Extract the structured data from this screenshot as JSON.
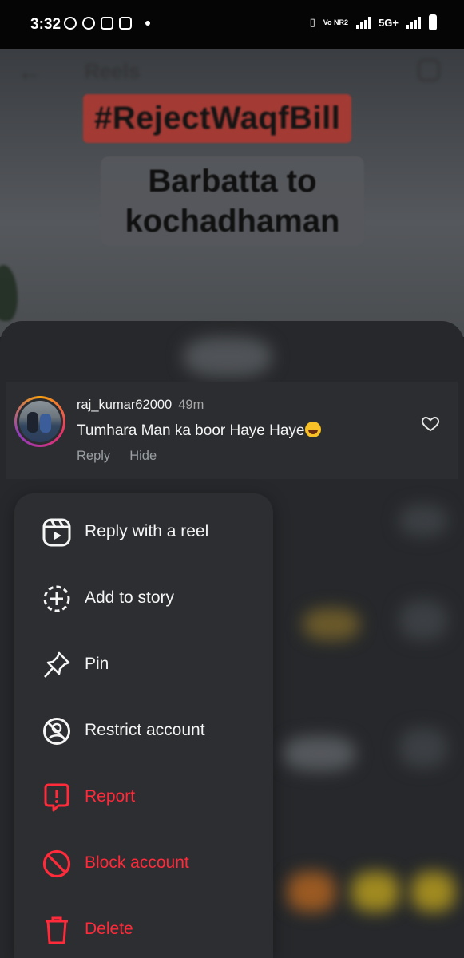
{
  "status_bar": {
    "time": "3:32",
    "network": "5G+",
    "volte": "Vo NR2"
  },
  "reel": {
    "header_title": "Reels",
    "hashtag": "#RejectWaqfBill",
    "caption_line1": "Barbatta to",
    "caption_line2": "kochadhaman"
  },
  "comment": {
    "username": "raj_kumar62000",
    "time": "49m",
    "text": "Tumhara Man ka boor Haye Haye",
    "reply_label": "Reply",
    "hide_label": "Hide"
  },
  "menu": {
    "items": [
      {
        "label": "Reply with a reel",
        "icon": "reel-icon",
        "danger": false
      },
      {
        "label": "Add to story",
        "icon": "add-story-icon",
        "danger": false
      },
      {
        "label": "Pin",
        "icon": "pin-icon",
        "danger": false
      },
      {
        "label": "Restrict account",
        "icon": "restrict-icon",
        "danger": false
      },
      {
        "label": "Report",
        "icon": "report-icon",
        "danger": true
      },
      {
        "label": "Block account",
        "icon": "block-icon",
        "danger": true
      },
      {
        "label": "Delete",
        "icon": "trash-icon",
        "danger": true
      }
    ]
  },
  "colors": {
    "danger": "#ff2a3a",
    "sheet_bg": "#26282b",
    "menu_bg": "#2c2e31"
  }
}
